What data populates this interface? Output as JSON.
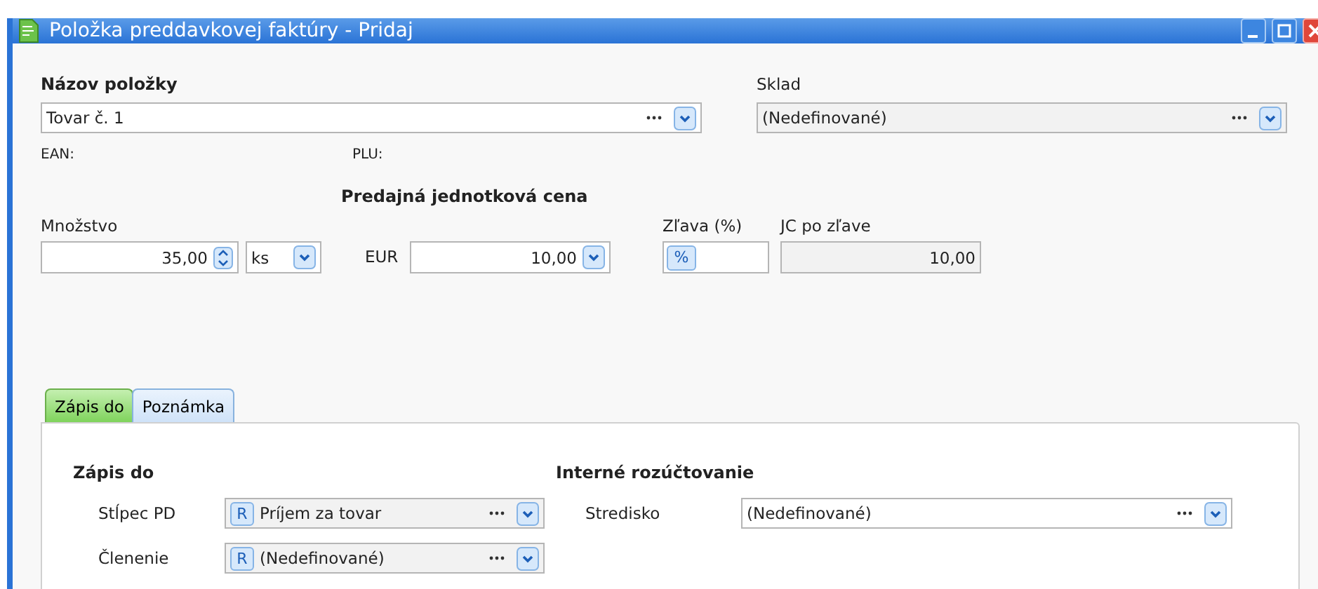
{
  "window": {
    "title": "Položka preddavkovej faktúry - Pridaj"
  },
  "item_name": {
    "label": "Názov položky",
    "value": "Tovar č. 1"
  },
  "warehouse": {
    "label": "Sklad",
    "value": "(Nedefinované)"
  },
  "ean_label": "EAN:",
  "plu_label": "PLU:",
  "price_heading": "Predajná jednotková cena",
  "quantity": {
    "label": "Množstvo",
    "value": "35,00",
    "unit": "ks"
  },
  "price": {
    "currency": "EUR",
    "value": "10,00"
  },
  "discount": {
    "label": "Zľava (%)",
    "button": "%"
  },
  "discounted_price": {
    "label": "JC po zľave",
    "value": "10,00"
  },
  "tabs": [
    {
      "label": "Zápis do",
      "selected": true
    },
    {
      "label": "Poznámka",
      "selected": false
    }
  ],
  "posting": {
    "heading": "Zápis do",
    "rows": [
      {
        "label": "Stĺpec PD",
        "prefix": "R",
        "value": "Príjem za tovar"
      },
      {
        "label": "Členenie",
        "prefix": "R",
        "value": "(Nedefinované)"
      }
    ]
  },
  "allocation": {
    "heading": "Interné rozúčtovanie",
    "rows": [
      {
        "label": "Stredisko",
        "value": "(Nedefinované)"
      }
    ]
  }
}
